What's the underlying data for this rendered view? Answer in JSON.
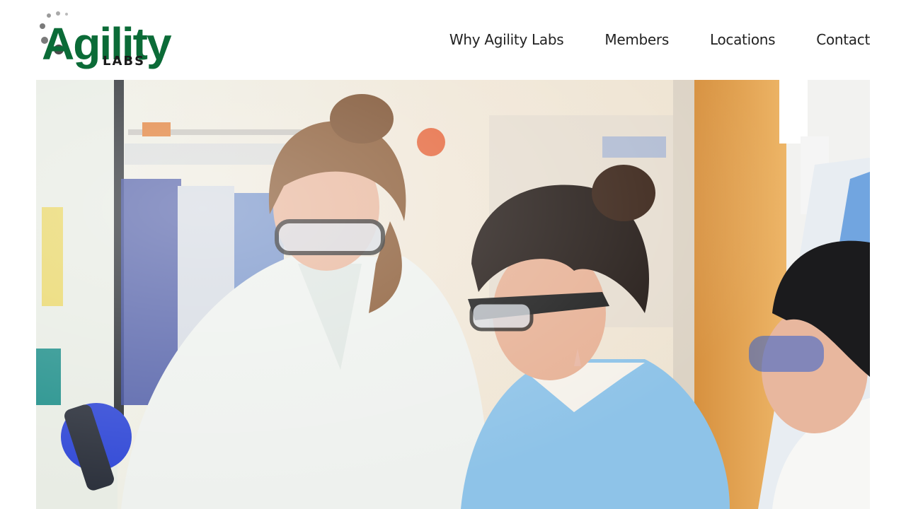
{
  "brand": {
    "logo_word": "Agility",
    "logo_sub": "LABS",
    "colors": {
      "green": "#0b6b37",
      "dark": "#1a1a1a",
      "dots": "#888888"
    }
  },
  "nav": {
    "items": [
      {
        "label": "Why Agility Labs"
      },
      {
        "label": "Members"
      },
      {
        "label": "Locations"
      },
      {
        "label": "Contact"
      }
    ]
  },
  "hero": {
    "image_description": "three-lab-workers-photo",
    "colors": {
      "wall": "#ece4d6",
      "door": "#e3a24e",
      "white_coat": "#eef1ee",
      "blue_gown": "#8ec3e8",
      "glove": "#2f47d6"
    }
  }
}
